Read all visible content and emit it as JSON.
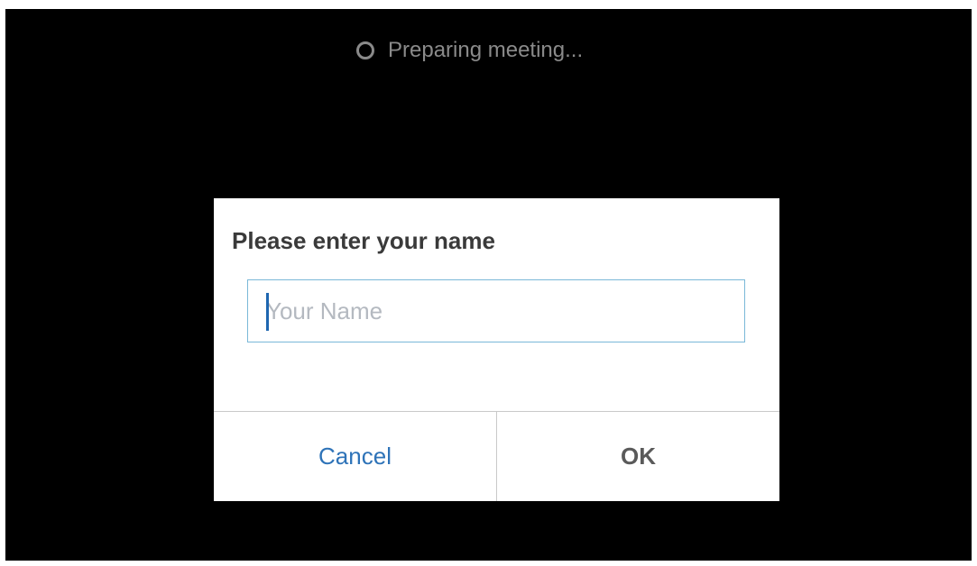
{
  "status": {
    "icon": "spinner-icon",
    "text": "Preparing meeting..."
  },
  "dialog": {
    "title": "Please enter your name",
    "name_input": {
      "value": "",
      "placeholder": "Your Name"
    },
    "buttons": {
      "cancel_label": "Cancel",
      "ok_label": "OK"
    }
  },
  "colors": {
    "background": "#000000",
    "dialog_background": "#ffffff",
    "cancel_text": "#2e73b8",
    "input_border": "#7ab8d8",
    "caret": "#1e66b0"
  }
}
